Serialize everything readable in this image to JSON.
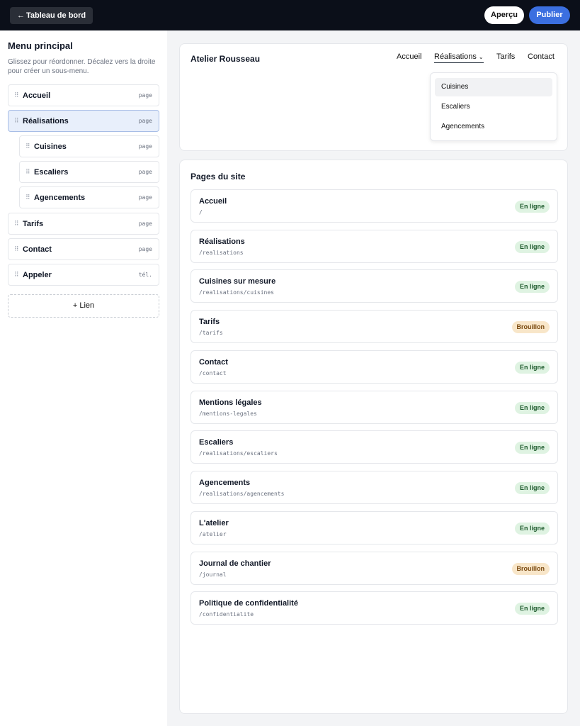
{
  "topbar": {
    "back_label": "Tableau de bord",
    "preview_label": "Aperçu",
    "publish_label": "Publier"
  },
  "sidebar": {
    "title": "Menu principal",
    "hint": "Glissez pour réordonner. Décalez vers la droite pour créer un sous-menu.",
    "items": [
      {
        "label": "Accueil",
        "type": "page"
      },
      {
        "label": "Réalisations",
        "type": "page"
      },
      {
        "label": "Cuisines",
        "type": "page"
      },
      {
        "label": "Escaliers",
        "type": "page"
      },
      {
        "label": "Agencements",
        "type": "page"
      },
      {
        "label": "Tarifs",
        "type": "page"
      },
      {
        "label": "Contact",
        "type": "page"
      },
      {
        "label": "Appeler",
        "type": "tél."
      }
    ],
    "add_link_label": "+ Lien"
  },
  "preview": {
    "site_name": "Atelier Rousseau",
    "nav": [
      "Accueil",
      "Réalisations",
      "Tarifs",
      "Contact"
    ],
    "dropdown": [
      "Cuisines",
      "Escaliers",
      "Agencements"
    ]
  },
  "pages": {
    "title": "Pages du site",
    "rows": [
      {
        "title": "Accueil",
        "path": "/",
        "status": "En ligne"
      },
      {
        "title": "Réalisations",
        "path": "/realisations",
        "status": "En ligne"
      },
      {
        "title": "Cuisines sur mesure",
        "path": "/realisations/cuisines",
        "status": "En ligne"
      },
      {
        "title": "Tarifs",
        "path": "/tarifs",
        "status": "Brouillon"
      },
      {
        "title": "Contact",
        "path": "/contact",
        "status": "En ligne"
      },
      {
        "title": "Mentions légales",
        "path": "/mentions-legales",
        "status": "En ligne"
      },
      {
        "title": "Escaliers",
        "path": "/realisations/escaliers",
        "status": "En ligne"
      },
      {
        "title": "Agencements",
        "path": "/realisations/agencements",
        "status": "En ligne"
      },
      {
        "title": "L'atelier",
        "path": "/atelier",
        "status": "En ligne"
      },
      {
        "title": "Journal de chantier",
        "path": "/journal",
        "status": "Brouillon"
      },
      {
        "title": "Politique de confidentialité",
        "path": "/confidentialite",
        "status": "En ligne"
      }
    ]
  },
  "colors": {
    "accent": "#3b6fe0",
    "online_bg": "#dff3e2",
    "draft_bg": "#f8e6c9"
  }
}
